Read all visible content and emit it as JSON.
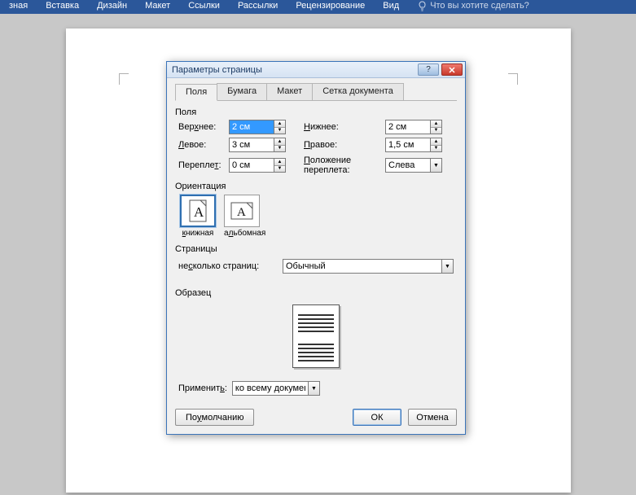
{
  "ribbon": {
    "tabs": [
      "зная",
      "Вставка",
      "Дизайн",
      "Макет",
      "Ссылки",
      "Рассылки",
      "Рецензирование",
      "Вид"
    ],
    "tellme": "Что вы хотите сделать?"
  },
  "dialog": {
    "title": "Параметры страницы",
    "tabs": {
      "margins": "Поля",
      "paper": "Бумага",
      "layout": "Макет",
      "grid": "Сетка документа"
    },
    "section_margins": "Поля",
    "top_label": "Верхнее:",
    "top_value": "2 см",
    "bottom_label": "Нижнее:",
    "bottom_value": "2 см",
    "left_label": "Левое:",
    "left_value": "3 см",
    "right_label": "Правое:",
    "right_value": "1,5 см",
    "gutter_label": "Переплет:",
    "gutter_value": "0 см",
    "gutter_pos_label": "Положение переплета:",
    "gutter_pos_value": "Слева",
    "section_orientation": "Ориентация",
    "portrait": "книжная",
    "landscape": "альбомная",
    "section_pages": "Страницы",
    "multi_pages_label": "несколько страниц:",
    "multi_pages_value": "Обычный",
    "section_preview": "Образец",
    "apply_label": "Применить:",
    "apply_value": "ко всему документу",
    "defaults": "По умолчанию",
    "ok": "ОК",
    "cancel": "Отмена"
  }
}
